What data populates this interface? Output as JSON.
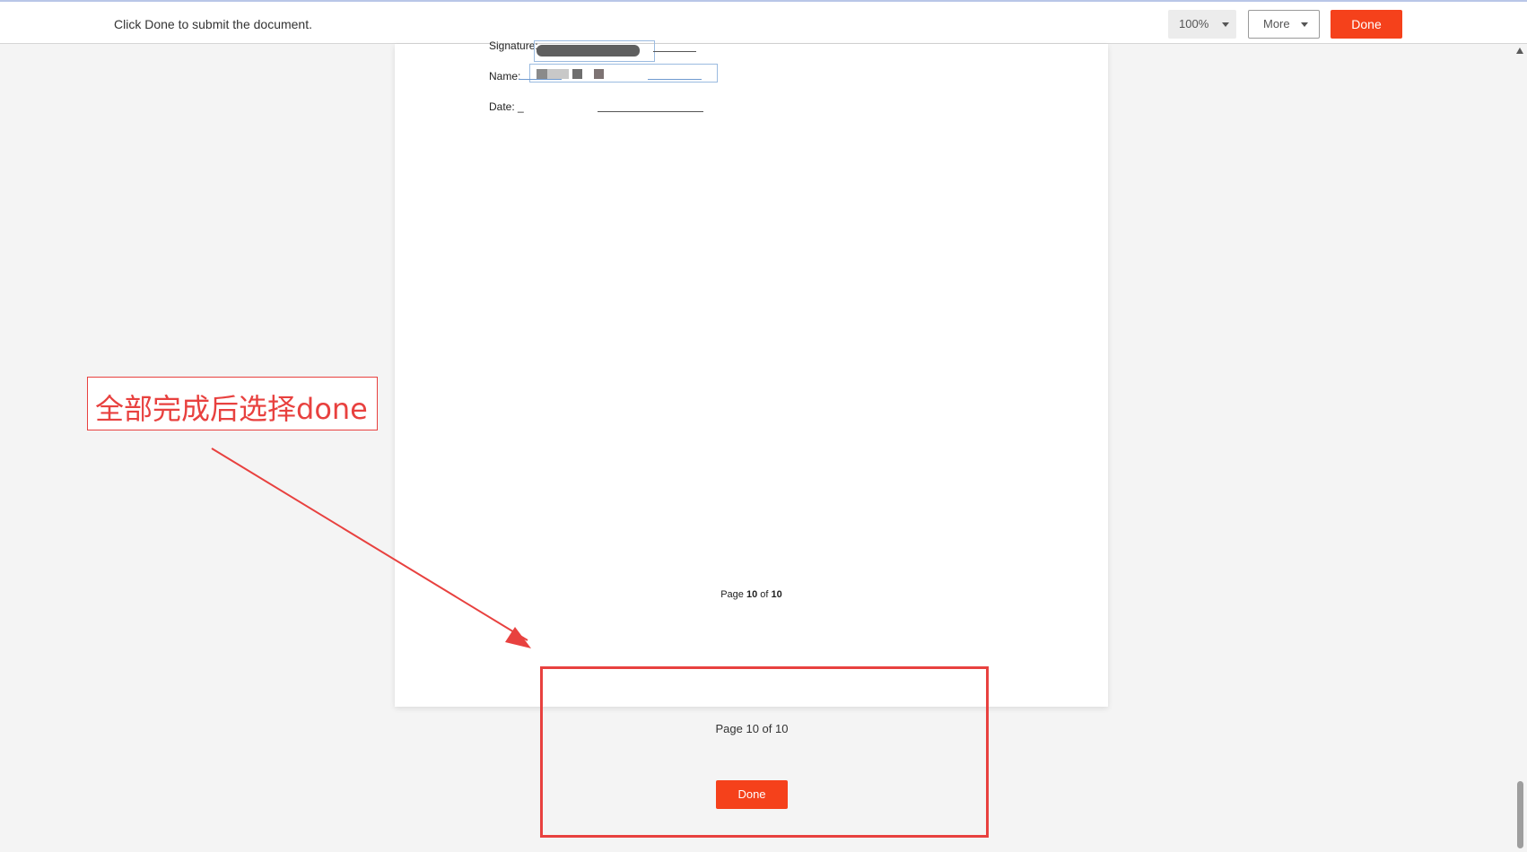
{
  "toolbar": {
    "instruction": "Click Done to submit the document.",
    "zoom_value": "100%",
    "more_label": "More",
    "done_label": "Done"
  },
  "document": {
    "signature_label": "Signature:",
    "name_label": "Name:",
    "date_label": "Date: _",
    "page_number_prefix": "Page",
    "page_current": "10",
    "page_of": "of",
    "page_total": "10"
  },
  "footer": {
    "page_indicator": "Page 10 of 10",
    "done_label": "Done"
  },
  "annotation": {
    "text": "全部完成后选择done"
  },
  "icons": {
    "zoom_dropdown": "caret-down-icon",
    "more_dropdown": "caret-down-icon",
    "scroll_up": "triangle-up-icon",
    "arrow": "red-arrow"
  },
  "colors": {
    "accent": "#f5411b",
    "annotation": "#e8413f",
    "field_border": "#9bbbe0"
  }
}
